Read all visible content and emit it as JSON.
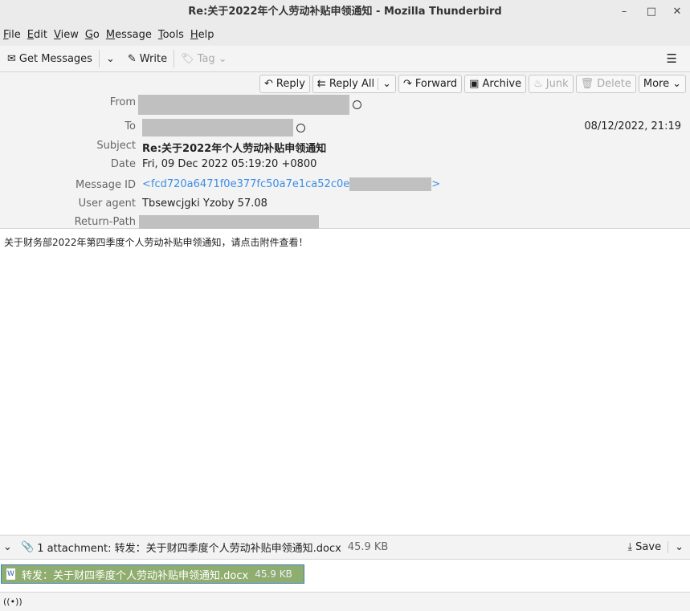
{
  "window": {
    "title": "Re:关于2022年个人劳动补贴申领通知 - Mozilla Thunderbird",
    "minimize": "–",
    "maximize": "□",
    "close": "✕"
  },
  "menu": [
    {
      "label": "File",
      "key": "F",
      "rest": "ile"
    },
    {
      "label": "Edit",
      "key": "E",
      "rest": "dit"
    },
    {
      "label": "View",
      "key": "V",
      "rest": "iew"
    },
    {
      "label": "Go",
      "key": "G",
      "rest": "o"
    },
    {
      "label": "Message",
      "key": "M",
      "rest": "essage"
    },
    {
      "label": "Tools",
      "key": "T",
      "rest": "ools"
    },
    {
      "label": "Help",
      "key": "H",
      "rest": "elp"
    }
  ],
  "toolbar": {
    "get_messages": "Get Messages",
    "write": "Write",
    "tag": "Tag",
    "menu_icon": "☰"
  },
  "actions": {
    "reply": "Reply",
    "reply_all": "Reply All",
    "forward": "Forward",
    "archive": "Archive",
    "junk": "Junk",
    "delete": "Delete",
    "more": "More"
  },
  "header": {
    "from_label": "From",
    "to_label": "To",
    "date_short": "08/12/2022, 21:19",
    "subject_label": "Subject",
    "subject": "Re:关于2022年个人劳动补贴申领通知",
    "date_label": "Date",
    "date": "Fri, 09 Dec 2022 05:19:20 +0800",
    "message_id_label": "Message ID",
    "message_id": "<fcd720a6471f0e377fc50a7e1ca52c0e",
    "message_id_end": ">",
    "user_agent_label": "User agent",
    "user_agent": "Tbsewcjgki Yzoby 57.08",
    "return_path_label": "Return-Path"
  },
  "body": "关于财务部2022年第四季度个人劳动补贴申领通知，请点击附件查看！",
  "attachments": {
    "summary": "1 attachment: 转发：关于财四季度个人劳动补贴申领通知.docx",
    "summary_size": "45.9 KB",
    "save": "Save",
    "items": [
      {
        "name": "转发：关于财四季度个人劳动补贴申领通知.docx",
        "size": "45.9 KB"
      }
    ]
  },
  "colors": {
    "link": "#3c8ee6",
    "attachment_bg": "#8fad6e",
    "attachment_border": "#3d7fc6"
  }
}
